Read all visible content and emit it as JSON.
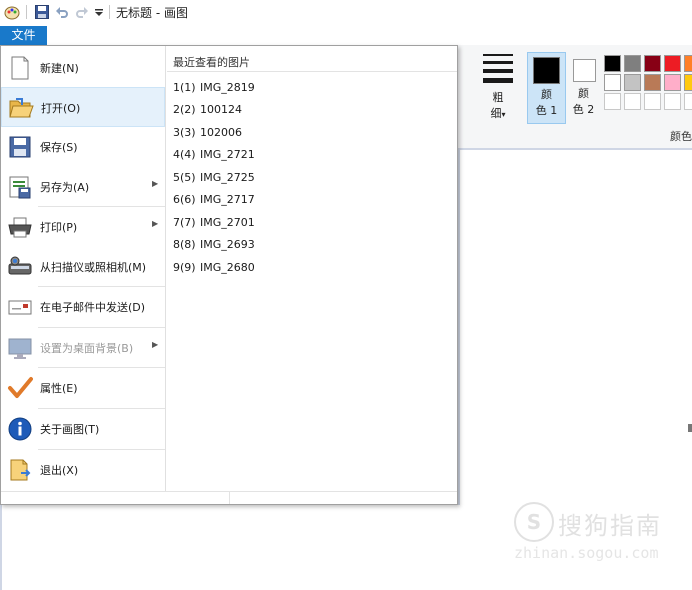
{
  "window": {
    "title": "无标题 - 画图"
  },
  "file_tab": {
    "label": "文件"
  },
  "ribbon": {
    "thickness_label_1": "粗",
    "thickness_label_2": "细",
    "thickness_arrow": "▾",
    "color1_label_1": "颜",
    "color1_label_2": "色 1",
    "color2_label_1": "颜",
    "color2_label_2": "色 2",
    "colors_group_label": "颜色",
    "color1_value": "#000000",
    "color2_value": "#ffffff",
    "palette_row1": [
      "#000000",
      "#7f7f7f",
      "#880015",
      "#ed1c24",
      "#ff7f27"
    ],
    "palette_row2": [
      "#ffffff",
      "#c3c3c3",
      "#b97a57",
      "#ffaec9",
      "#ffc90e"
    ],
    "palette_row3": [
      "#ffffff",
      "#ffffff",
      "#ffffff",
      "#ffffff",
      "#ffffff"
    ]
  },
  "file_menu": {
    "items": [
      {
        "label": "新建(N)",
        "icon": "new-file-icon"
      },
      {
        "label": "打开(O)",
        "icon": "open-folder-icon",
        "selected": true
      },
      {
        "label": "保存(S)",
        "icon": "save-icon"
      },
      {
        "label": "另存为(A)",
        "icon": "save-as-icon",
        "has_submenu": true
      },
      {
        "label": "打印(P)",
        "icon": "printer-icon",
        "has_submenu": true
      },
      {
        "label": "从扫描仪或照相机(M)",
        "icon": "scanner-icon"
      },
      {
        "label": "在电子邮件中发送(D)",
        "icon": "email-icon"
      },
      {
        "label": "设置为桌面背景(B)",
        "icon": "desktop-background-icon",
        "has_submenu": true,
        "disabled": true
      },
      {
        "label": "属性(E)",
        "icon": "checkmark-icon"
      },
      {
        "label": "关于画图(T)",
        "icon": "info-icon"
      },
      {
        "label": "退出(X)",
        "icon": "exit-icon"
      }
    ],
    "submenu_arrow": "▶",
    "recent_title": "最近查看的图片",
    "recent": [
      {
        "num": "1(1)",
        "name": "IMG_2819"
      },
      {
        "num": "2(2)",
        "name": "100124"
      },
      {
        "num": "3(3)",
        "name": "102006"
      },
      {
        "num": "4(4)",
        "name": "IMG_2721"
      },
      {
        "num": "5(5)",
        "name": "IMG_2725"
      },
      {
        "num": "6(6)",
        "name": "IMG_2717"
      },
      {
        "num": "7(7)",
        "name": "IMG_2701"
      },
      {
        "num": "8(8)",
        "name": "IMG_2693"
      },
      {
        "num": "9(9)",
        "name": "IMG_2680"
      }
    ]
  },
  "watermark": {
    "logo_letter": "S",
    "brand": "搜狗指南",
    "url": "zhinan.sogou.com"
  }
}
